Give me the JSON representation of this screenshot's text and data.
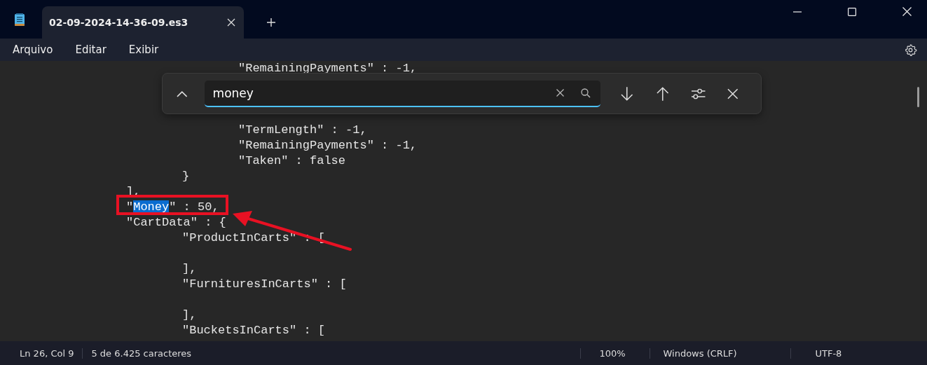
{
  "window": {
    "tab_title": "02-09-2024-14-36-09.es3"
  },
  "menu": [
    "Arquivo",
    "Editar",
    "Exibir"
  ],
  "find": {
    "value": "money"
  },
  "code_top": [
    {
      "children": [
        {
          "children": [
            {
              "parts": [
                {
                  "text": "\"RemainingPayments\" : -1,",
                  "selected": false
                }
              ]
            }
          ]
        }
      ]
    }
  ],
  "code": [
    {
      "children": [
        {
          "children": [
            {
              "parts": [
                {
                  "text": "\"TermLength\" : -1,",
                  "selected": false
                }
              ]
            },
            {
              "parts": [
                {
                  "text": "\"RemainingPayments\" : -1,",
                  "selected": false
                }
              ]
            },
            {
              "parts": [
                {
                  "text": "\"Taken\" : false",
                  "selected": false
                }
              ]
            }
          ]
        },
        {
          "parts": [
            {
              "text": "}",
              "selected": false
            }
          ]
        }
      ]
    },
    {
      "parts": [
        {
          "text": "],",
          "selected": false
        }
      ]
    },
    {
      "parts": [
        {
          "text": "\"",
          "selected": false
        },
        {
          "text": "Money",
          "selected": true
        },
        {
          "text": "\" : 50,",
          "selected": false
        }
      ]
    },
    {
      "parts": [
        {
          "text": "\"CartData\" : {",
          "selected": false
        }
      ],
      "children": [
        {
          "parts": [
            {
              "text": "\"ProductInCarts\" : [",
              "selected": false
            }
          ]
        },
        {
          "kind": "blank"
        },
        {
          "parts": [
            {
              "text": "],",
              "selected": false
            }
          ]
        },
        {
          "parts": [
            {
              "text": "\"FurnituresInCarts\" : [",
              "selected": false
            }
          ]
        },
        {
          "kind": "blank"
        },
        {
          "parts": [
            {
              "text": "],",
              "selected": false
            }
          ]
        },
        {
          "parts": [
            {
              "text": "\"BucketsInCarts\" : [",
              "selected": false
            }
          ]
        }
      ]
    }
  ],
  "status_bar": [
    "Ln 26, Col 9",
    "5 de 6.425 caracteres",
    "100%",
    "Windows (CRLF)",
    "UTF-8"
  ]
}
